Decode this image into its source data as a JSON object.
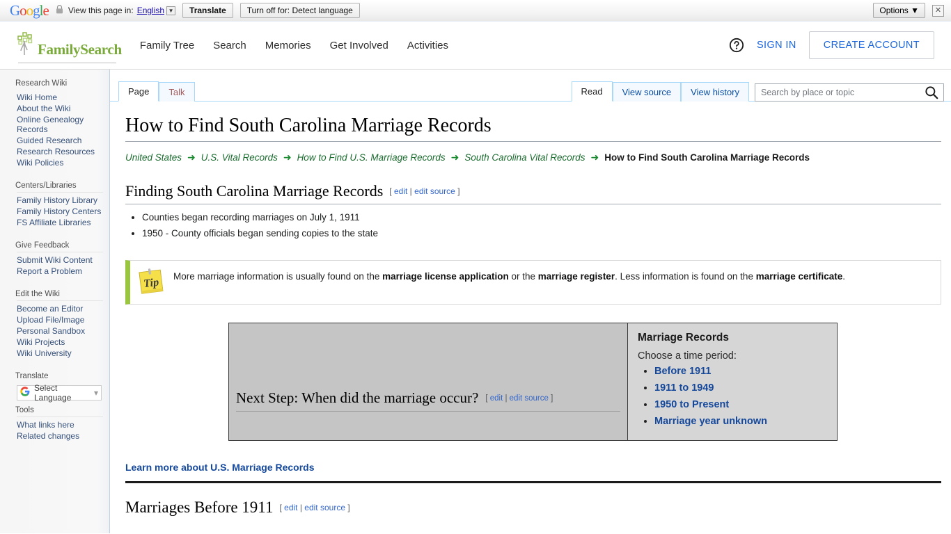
{
  "translate_bar": {
    "brand": "Google",
    "brand_letters": [
      "G",
      "o",
      "o",
      "g",
      "l",
      "e"
    ],
    "lock_icon": "lock-icon",
    "label": "View this page in:",
    "language": "English",
    "translate_button": "Translate",
    "turn_off_button": "Turn off for: Detect language",
    "options_button": "Options",
    "close_icon": "close-icon"
  },
  "header": {
    "logo_text": "FamilySearch",
    "nav": [
      {
        "label": "Family Tree"
      },
      {
        "label": "Search"
      },
      {
        "label": "Memories"
      },
      {
        "label": "Get Involved"
      },
      {
        "label": "Activities"
      }
    ],
    "help_icon": "help-circle-icon",
    "sign_in": "SIGN IN",
    "create_account": "CREATE ACCOUNT"
  },
  "sidebar": {
    "groups": [
      {
        "title": "Research Wiki",
        "items": [
          "Wiki Home",
          "About the Wiki",
          "Online Genealogy Records",
          "Guided Research",
          "Research Resources",
          "Wiki Policies"
        ]
      },
      {
        "title": "Centers/Libraries",
        "items": [
          "Family History Library",
          "Family History Centers",
          "FS Affiliate Libraries"
        ]
      },
      {
        "title": "Give Feedback",
        "items": [
          "Submit Wiki Content",
          "Report a Problem"
        ]
      },
      {
        "title": "Edit the Wiki",
        "items": [
          "Become an Editor",
          "Upload File/Image",
          "Personal Sandbox",
          "Wiki Projects",
          "Wiki University"
        ]
      }
    ],
    "translate_title": "Translate",
    "language_widget": {
      "icon": "google-g-icon",
      "label": "Select Language"
    },
    "tools_title": "Tools",
    "tools_items": [
      "What links here",
      "Related changes"
    ]
  },
  "tabs": {
    "left": [
      {
        "label": "Page",
        "state": "active"
      },
      {
        "label": "Talk",
        "state": "redlink"
      }
    ],
    "right": [
      {
        "label": "Read",
        "state": "active"
      },
      {
        "label": "View source",
        "state": "normal"
      },
      {
        "label": "View history",
        "state": "normal"
      }
    ]
  },
  "search": {
    "placeholder": "Search by place or topic",
    "value": "",
    "icon": "search-icon"
  },
  "main": {
    "page_title": "How to Find South Carolina Marriage Records",
    "breadcrumb": {
      "links": [
        "United States",
        "U.S. Vital Records",
        "How to Find U.S. Marriage Records",
        "South Carolina Vital Records"
      ],
      "arrow": "➜",
      "current": "How to Find South Carolina Marriage Records"
    },
    "section1": {
      "heading": "Finding South Carolina Marriage Records",
      "edit_open": "[",
      "edit": "edit",
      "edit_sep": "|",
      "edit_source": "edit source",
      "edit_close": "]",
      "bullets": [
        "Counties began recording marriages on July 1, 1911",
        "1950 - County officials began sending copies to the state"
      ]
    },
    "tip": {
      "icon": "tip-note-icon",
      "icon_label": "Tip",
      "text_parts": [
        {
          "t": "More marriage information is usually found on the ",
          "bold": false
        },
        {
          "t": "marriage license application",
          "bold": true
        },
        {
          "t": " or the ",
          "bold": false
        },
        {
          "t": "marriage register",
          "bold": true
        },
        {
          "t": ". Less information is found on the ",
          "bold": false
        },
        {
          "t": "marriage certificate",
          "bold": true
        },
        {
          "t": ".",
          "bold": false
        }
      ],
      "full_text": "More marriage information is usually found on the marriage license application or the marriage register. Less information is found on the marriage certificate."
    },
    "next_step": {
      "heading": "Next Step: When did the marriage occur?",
      "edit": "edit",
      "edit_source": "edit source"
    },
    "records_panel": {
      "title": "Marriage Records",
      "subtitle": "Choose a time period:",
      "links": [
        "Before 1911",
        "1911 to 1949",
        "1950 to Present",
        "Marriage year unknown"
      ]
    },
    "learn_more": "Learn more about U.S. Marriage Records",
    "section2": {
      "heading": "Marriages Before 1911",
      "edit": "edit",
      "edit_source": "edit source"
    }
  },
  "colors": {
    "fs_green": "#7aab3a",
    "link_blue": "#3366cc",
    "breadcrumb_green": "#1a6b2e",
    "panel_link_blue": "#14489c",
    "tab_border": "#a7d7f9",
    "tip_accent": "#9ac53e"
  }
}
